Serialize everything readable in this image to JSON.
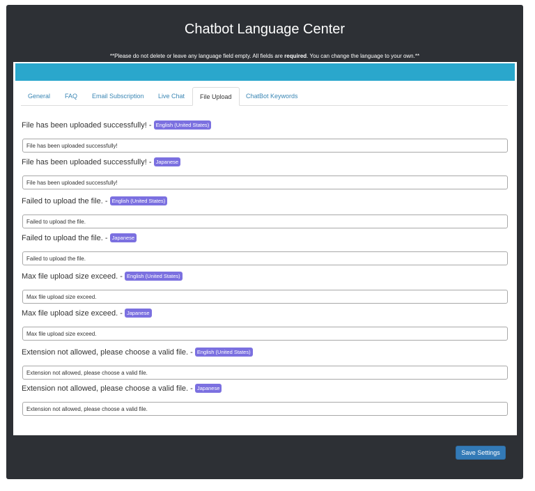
{
  "header": {
    "title": "Chatbot Language Center",
    "notice_prefix": "**Please do not delete or leave any language field empty. All fields are ",
    "notice_bold": "required",
    "notice_suffix": ". You can change the language to your own.**"
  },
  "tabs": [
    {
      "label": "General",
      "active": false
    },
    {
      "label": "FAQ",
      "active": false
    },
    {
      "label": "Email Subscription",
      "active": false
    },
    {
      "label": "Live Chat",
      "active": false
    },
    {
      "label": "File Upload",
      "active": true
    },
    {
      "label": "ChatBot Keywords",
      "active": false
    }
  ],
  "fields": [
    {
      "label": "File has been uploaded successfully! - ",
      "language": "English (United States)",
      "value": "File has been uploaded successfully!"
    },
    {
      "label": "File has been uploaded successfully! - ",
      "language": "Japanese",
      "value": "File has been uploaded successfully!"
    },
    {
      "label": "Failed to upload the file. - ",
      "language": "English (United States)",
      "value": "Failed to upload the file."
    },
    {
      "label": "Failed to upload the file. - ",
      "language": "Japanese",
      "value": "Failed to upload the file."
    },
    {
      "label": "Max file upload size exceed. - ",
      "language": "English (United States)",
      "value": "Max file upload size exceed."
    },
    {
      "label": "Max file upload size exceed. - ",
      "language": "Japanese",
      "value": "Max file upload size exceed."
    },
    {
      "label": "Extension not allowed, please choose a valid file. - ",
      "language": "English (United States)",
      "value": "Extension not allowed, please choose a valid file."
    },
    {
      "label": "Extension not allowed, please choose a valid file. - ",
      "language": "Japanese",
      "value": "Extension not allowed, please choose a valid file."
    }
  ],
  "footer": {
    "save_label": "Save Settings"
  },
  "colors": {
    "frame": "#2d3035",
    "panel_bar": "#2aa7cc",
    "badge": "#7b70e0",
    "save_button": "#337ab7",
    "tab_link": "#3a86b4"
  }
}
